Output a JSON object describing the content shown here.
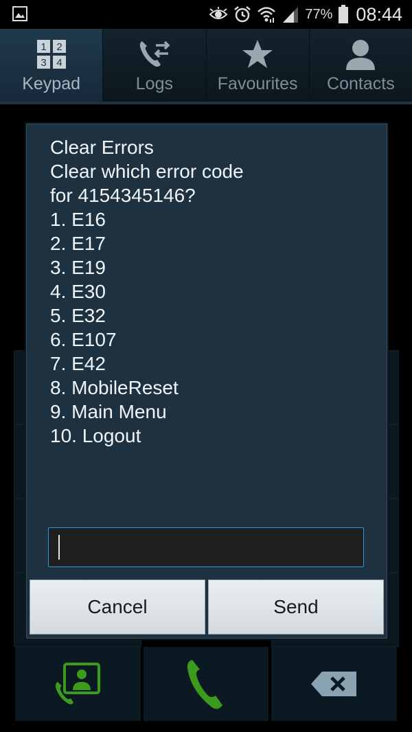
{
  "status_bar": {
    "icons": [
      "gallery-icon",
      "eye-icon",
      "alarm-icon",
      "wifi-icon",
      "signal-icon",
      "battery-icon"
    ],
    "battery_percent": "77%",
    "time": "08:44"
  },
  "tabs": [
    {
      "label": "Keypad",
      "icon": "keypad-icon",
      "active": true
    },
    {
      "label": "Logs",
      "icon": "call-log-icon",
      "active": false
    },
    {
      "label": "Favourites",
      "icon": "star-icon",
      "active": false
    },
    {
      "label": "Contacts",
      "icon": "contact-icon",
      "active": false
    }
  ],
  "dialog": {
    "lines": [
      "Clear Errors",
      "Clear which error code",
      "for 4154345146?",
      "1. E16",
      "2. E17",
      "3. E19",
      "4. E30",
      "5. E32",
      "6. E107",
      "7. E42",
      "8. MobileReset",
      "9. Main Menu",
      "10. Logout"
    ],
    "input_value": "",
    "cancel_label": "Cancel",
    "send_label": "Send"
  },
  "bottom_bar": {
    "icons": [
      "video-call-contact-icon",
      "phone-call-icon",
      "backspace-icon"
    ],
    "colors": {
      "green": "#3c9a1c",
      "backspace": "#8aa3b2"
    }
  }
}
